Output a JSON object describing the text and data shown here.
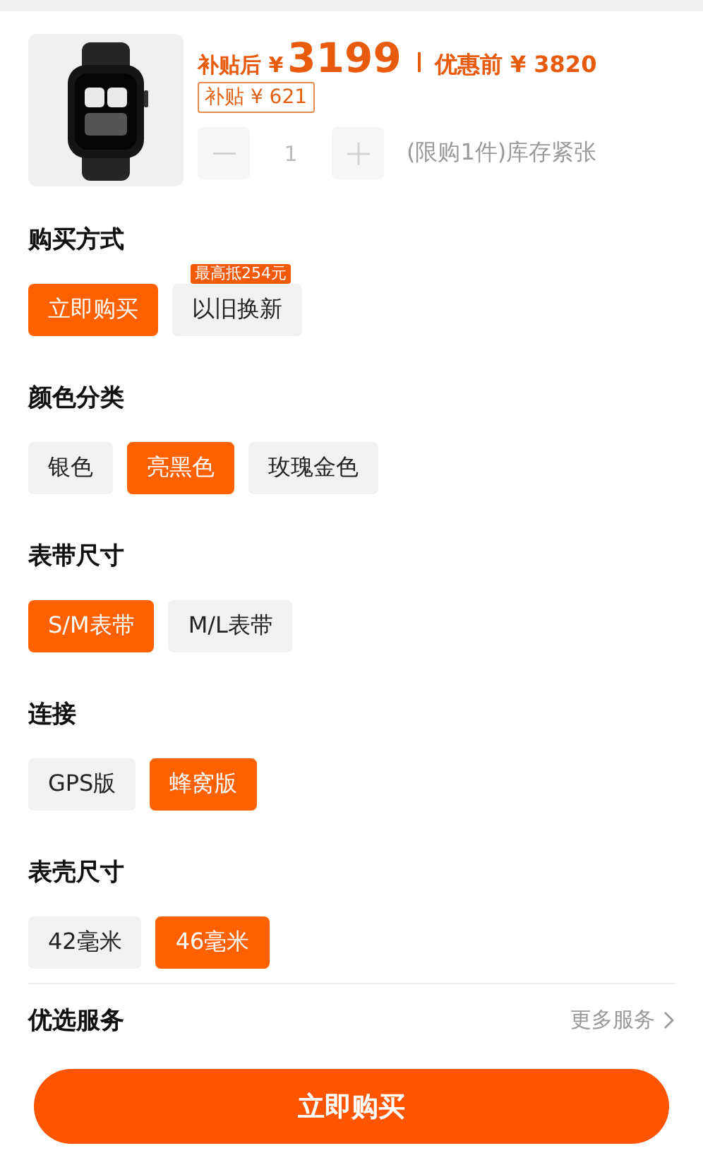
{
  "product": {
    "price_prefix": "补贴后 ¥",
    "price": "3199",
    "original_price": "优惠前 ¥ 3820",
    "subsidy": "补贴 ¥ 621",
    "quantity": "1",
    "stepper_disabled": true,
    "limit_note": "(限购1件)库存紧张"
  },
  "sections": [
    {
      "title": "购买方式",
      "options": [
        {
          "label": "立即购买",
          "selected": true
        },
        {
          "label": "以旧换新",
          "selected": false,
          "badge": "最高抵254元"
        }
      ]
    },
    {
      "title": "颜色分类",
      "options": [
        {
          "label": "银色",
          "selected": false
        },
        {
          "label": "亮黑色",
          "selected": true
        },
        {
          "label": "玫瑰金色",
          "selected": false
        }
      ]
    },
    {
      "title": "表带尺寸",
      "options": [
        {
          "label": "S/M表带",
          "selected": true
        },
        {
          "label": "M/L表带",
          "selected": false
        }
      ]
    },
    {
      "title": "连接",
      "options": [
        {
          "label": "GPS版",
          "selected": false
        },
        {
          "label": "蜂窝版",
          "selected": true
        }
      ]
    },
    {
      "title": "表壳尺寸",
      "options": [
        {
          "label": "42毫米",
          "selected": false
        },
        {
          "label": "46毫米",
          "selected": true
        }
      ]
    }
  ],
  "services": {
    "title": "优选服务",
    "more": "更多服务"
  },
  "buy_button": "立即购买"
}
